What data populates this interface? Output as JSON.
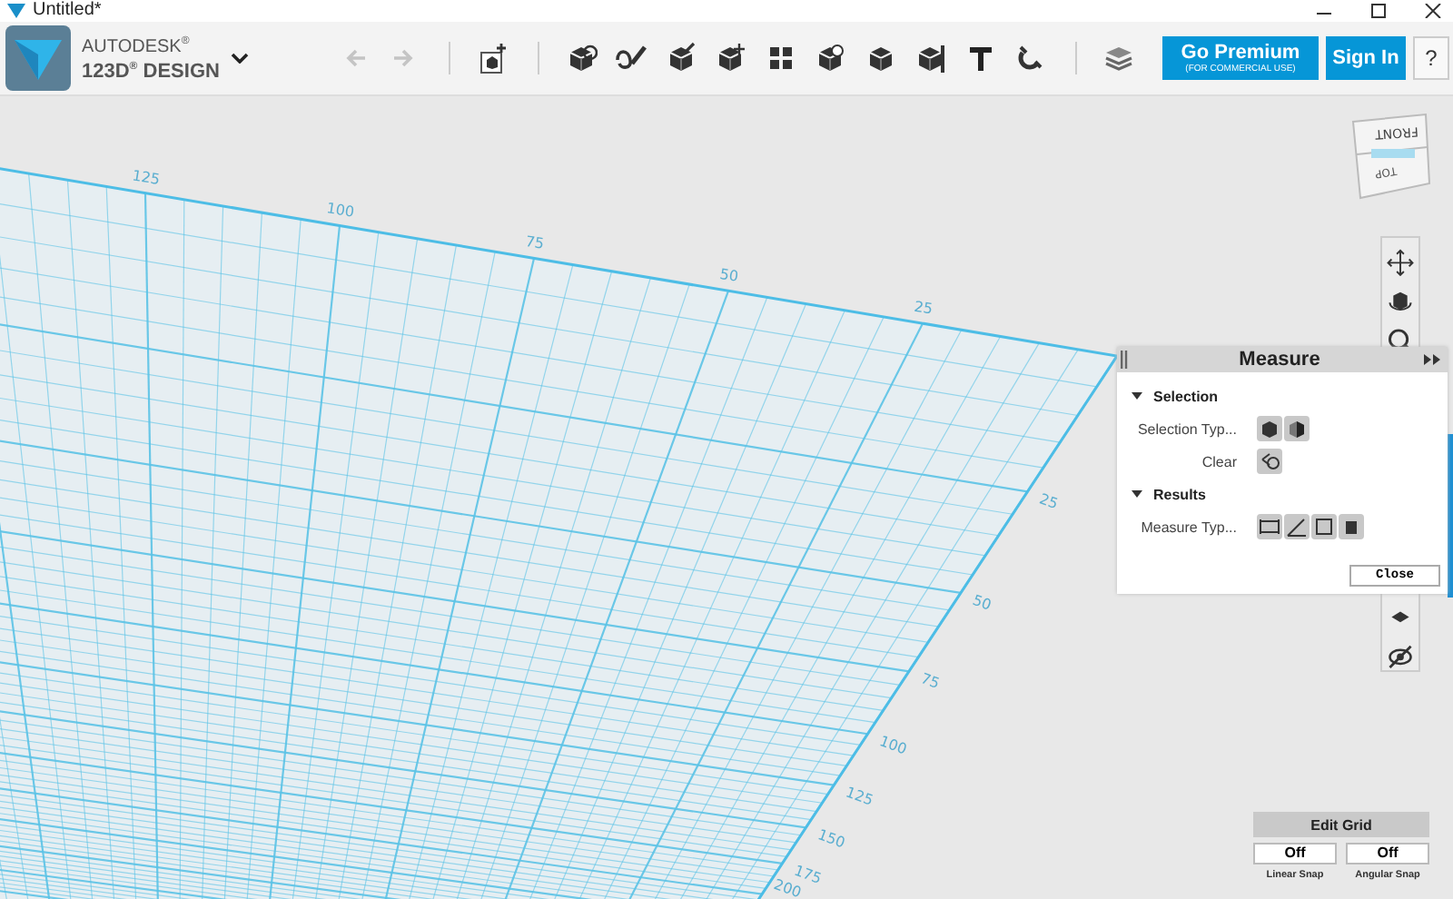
{
  "window": {
    "title": "Untitled*"
  },
  "toolbar": {
    "brand_top": "AUTODESK$^{®}$",
    "brand_bottom": "123D$^{®}$ DESIGN",
    "history": [
      {
        "kind": "undo",
        "disabled": true
      },
      {
        "kind": "redo",
        "disabled": true
      }
    ],
    "premium": {
      "label": "Go Premium",
      "sublabel": "(FOR COMMERCIAL USE)"
    },
    "sign_in": "Sign In",
    "help": "?"
  },
  "view_cube": {
    "front": "FRONT",
    "top": "TOP"
  },
  "grid": {
    "top_labels": [
      "25",
      "50",
      "75",
      "100",
      "125"
    ],
    "side_labels": [
      "25",
      "50",
      "75",
      "100",
      "125",
      "150",
      "175",
      "200"
    ]
  },
  "measure_panel": {
    "title": "Measure",
    "sections": [
      {
        "title": "Selection",
        "expanded": true,
        "rows": [
          {
            "label": "Selection Typ...",
            "buttons": [
              {
                "kind": "solid"
              },
              {
                "kind": "face"
              }
            ]
          },
          {
            "label": "Clear",
            "buttons": [
              {
                "kind": "clear"
              }
            ]
          }
        ]
      },
      {
        "title": "Results",
        "expanded": true,
        "rows": [
          {
            "label": "Measure Typ...",
            "buttons": [
              {
                "kind": "distance"
              },
              {
                "kind": "angle"
              },
              {
                "kind": "area"
              },
              {
                "kind": "volume"
              }
            ]
          }
        ]
      }
    ],
    "close": "Close"
  },
  "grid_controls": {
    "edit": "Edit Grid",
    "snaps": [
      {
        "value": "Off",
        "label": "Linear Snap"
      },
      {
        "value": "Off",
        "label": "Angular Snap"
      }
    ]
  }
}
